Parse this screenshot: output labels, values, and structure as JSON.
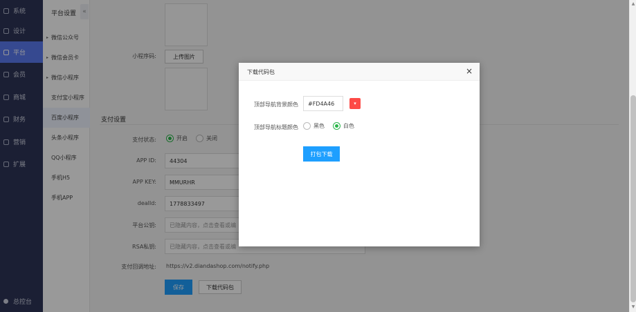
{
  "nav": {
    "items": [
      {
        "label": "系统",
        "icon": "gear-icon"
      },
      {
        "label": "设计",
        "icon": "monitor-icon"
      },
      {
        "label": "平台",
        "icon": "platform-icon",
        "active": true
      },
      {
        "label": "会员",
        "icon": "user-icon"
      },
      {
        "label": "商城",
        "icon": "shop-icon"
      },
      {
        "label": "财务",
        "icon": "finance-icon"
      },
      {
        "label": "营销",
        "icon": "marketing-icon"
      },
      {
        "label": "扩展",
        "icon": "extend-icon"
      }
    ],
    "footer": "总控台"
  },
  "submenu": {
    "title": "平台设置",
    "collapse": "«",
    "items": [
      {
        "label": "微信公众号",
        "caret": true
      },
      {
        "label": "微信会员卡",
        "caret": true
      },
      {
        "label": "微信小程序",
        "caret": true
      },
      {
        "label": "支付宝小程序"
      },
      {
        "label": "百度小程序",
        "active": true
      },
      {
        "label": "头条小程序"
      },
      {
        "label": "QQ小程序"
      },
      {
        "label": "手机H5"
      },
      {
        "label": "手机APP"
      }
    ]
  },
  "form": {
    "mini_qr_label": "小程序码:",
    "upload_btn": "上传图片",
    "pay_section": "支付设置",
    "pay_status_label": "支付状态:",
    "pay_on": "开启",
    "pay_off": "关闭",
    "appid_label": "APP ID:",
    "appid_value": "44304",
    "appkey_label": "APP KEY:",
    "appkey_value": "MMURHR",
    "dealid_label": "dealId:",
    "dealid_value": "1778833497",
    "pubkey_label": "平台公钥:",
    "pubkey_placeholder": "已隐藏内容，点击查看或编",
    "rsa_label": "RSA私钥:",
    "rsa_placeholder": "已隐藏内容，点击查看或编",
    "notify_label": "支付回调地址:",
    "notify_value": "https://v2.diandashop.com/notify.php",
    "save_btn": "保存",
    "download_btn": "下载代码包"
  },
  "modal": {
    "title": "下载代码包",
    "close": "×",
    "bg_color_label": "顶部导航背景颜色",
    "bg_color_value": "#FD4A46",
    "swatch_color": "#FD4A46",
    "title_color_label": "顶部导航标题颜色",
    "black": "黑色",
    "white": "白色",
    "submit": "打包下载"
  },
  "colors": {
    "accent": "#1e9fff",
    "nav_bg": "#2e3457",
    "nav_active": "#5b7bf0",
    "radio_on": "#2ab54a"
  }
}
